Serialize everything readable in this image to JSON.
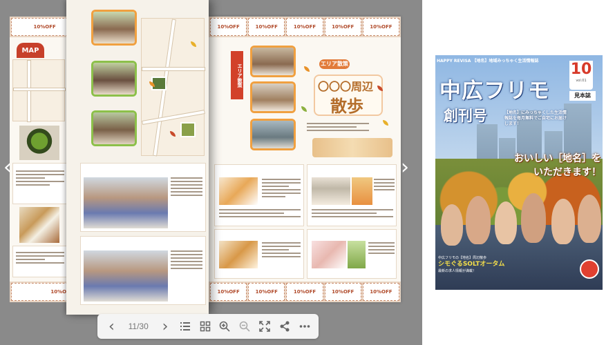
{
  "viewer": {
    "page_counter": "11/30",
    "prev_arrow": "‹",
    "next_arrow": "›",
    "toolbar": {
      "prev": "‹",
      "next": "›"
    }
  },
  "spread": {
    "map_label": "MAP",
    "coupon_text": "10%OFF",
    "section_label": "エリア散策",
    "title_placeholder": "〇〇〇周辺",
    "title_main": "散歩",
    "autumn_label": "秋"
  },
  "cover": {
    "header": "HAPPY REVISA 【地名】地域みっちゃく生活情報誌",
    "title": "中広フリモ",
    "issue_number": "10",
    "issue_vol": "vol.01",
    "sample": "見本誌",
    "subtitle": "創刊号",
    "description": "【地名】にみっちゃくした生活情報誌を毎月無料でご自宅にお届けします！",
    "catchcopy_line1": "おいしい［地名］を",
    "catchcopy_line2": "いただきます！",
    "bottom_line1": "中広フリモの【地名】周辺散歩",
    "bottom_line2": "シモぐるSOLTオータム",
    "bottom_line3": "最新の求人情報が満載！"
  },
  "colors": {
    "stage_bg": "#8a8a8a",
    "accent_orange": "#f0a040",
    "cover_blue": "#1d3c78",
    "title_brown": "#b46d2a"
  }
}
